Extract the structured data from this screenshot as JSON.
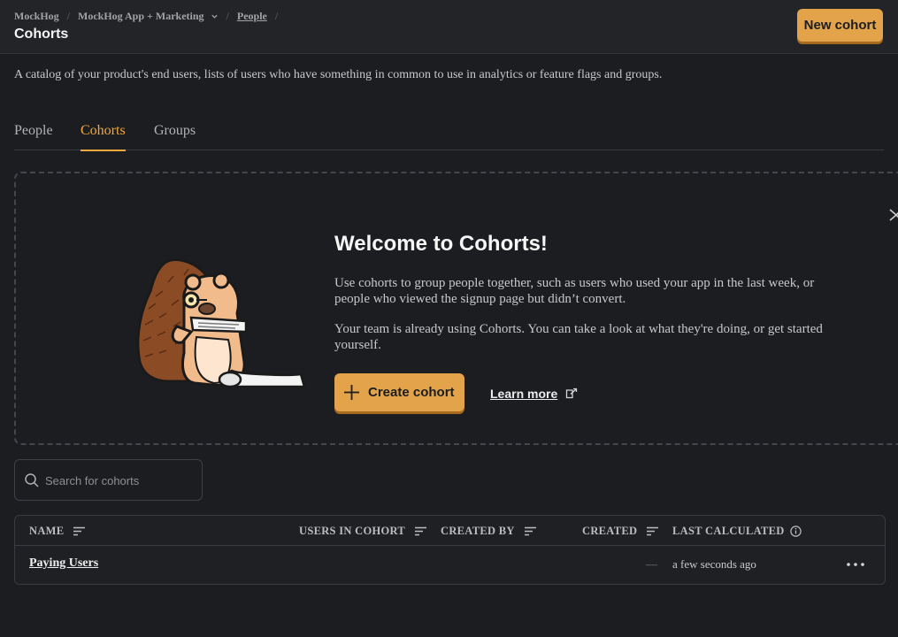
{
  "breadcrumb": {
    "org": "MockHog",
    "project": "MockHog App + Marketing",
    "section": "People",
    "separator": "/"
  },
  "header": {
    "title": "Cohorts",
    "new_button": "New cohort"
  },
  "description": "A catalog of your product's end users, lists of users who have something in common to use in analytics or feature flags and groups.",
  "tabs": [
    {
      "label": "People",
      "active": false
    },
    {
      "label": "Cohorts",
      "active": true
    },
    {
      "label": "Groups",
      "active": false
    }
  ],
  "welcome": {
    "title": "Welcome to Cohorts!",
    "paragraph1": "Use cohorts to group people together, such as users who used your app in the last week, or people who viewed the signup page but didn’t convert.",
    "paragraph2": "Your team is already using Cohorts. You can take a look at what they're doing, or get started yourself.",
    "create_button": "Create cohort",
    "learn_more": "Learn more"
  },
  "search": {
    "placeholder": "Search for cohorts",
    "value": ""
  },
  "table": {
    "columns": [
      "NAME",
      "USERS IN COHORT",
      "CREATED BY",
      "CREATED",
      "LAST CALCULATED"
    ],
    "rows": [
      {
        "name": "Paying Users",
        "users_in_cohort": "",
        "created_by": "",
        "created": "—",
        "last_calculated": "a few seconds ago"
      }
    ]
  },
  "colors": {
    "accent": "#f0a83d",
    "primary_button": "#e3a34b",
    "background": "#1c1d21",
    "topbar": "#232428"
  },
  "icons": [
    "chevron-down-icon",
    "close-icon",
    "hedgehog-illustration",
    "plus-icon",
    "external-link-icon",
    "search-icon",
    "sort-icon",
    "info-icon",
    "more-icon"
  ]
}
